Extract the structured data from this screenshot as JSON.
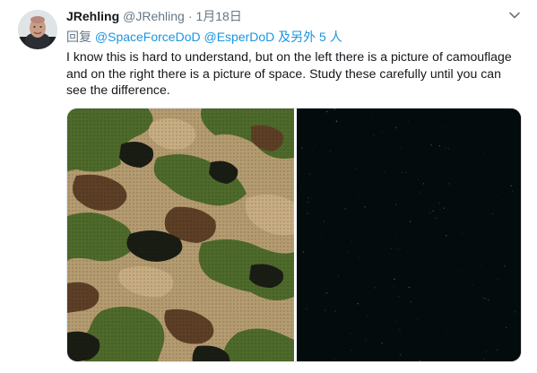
{
  "tweet": {
    "display_name": "JRehling",
    "handle": "@JRehling",
    "separator": "·",
    "date": "1月18日",
    "reply_prefix": "回复",
    "reply_mentions": [
      "@SpaceForceDoD",
      "@EsperDoD"
    ],
    "reply_suffix": "及另外 5 人",
    "text": "I know this is hard to understand, but on the left there is a picture of camouflage and on the right there is a picture of space. Study these carefully until you can see the difference."
  },
  "icons": {
    "avatar": "user-avatar",
    "caret": "chevron-down-icon"
  },
  "colors": {
    "link": "#1b95e0",
    "muted": "#657786",
    "text": "#14171a",
    "camo_khaki": "#b49b70",
    "camo_tan": "#c8ad82",
    "camo_green": "#4e6a2b",
    "camo_brown": "#5d3f26",
    "camo_dark": "#1a1d14",
    "space": "#040b0c"
  }
}
